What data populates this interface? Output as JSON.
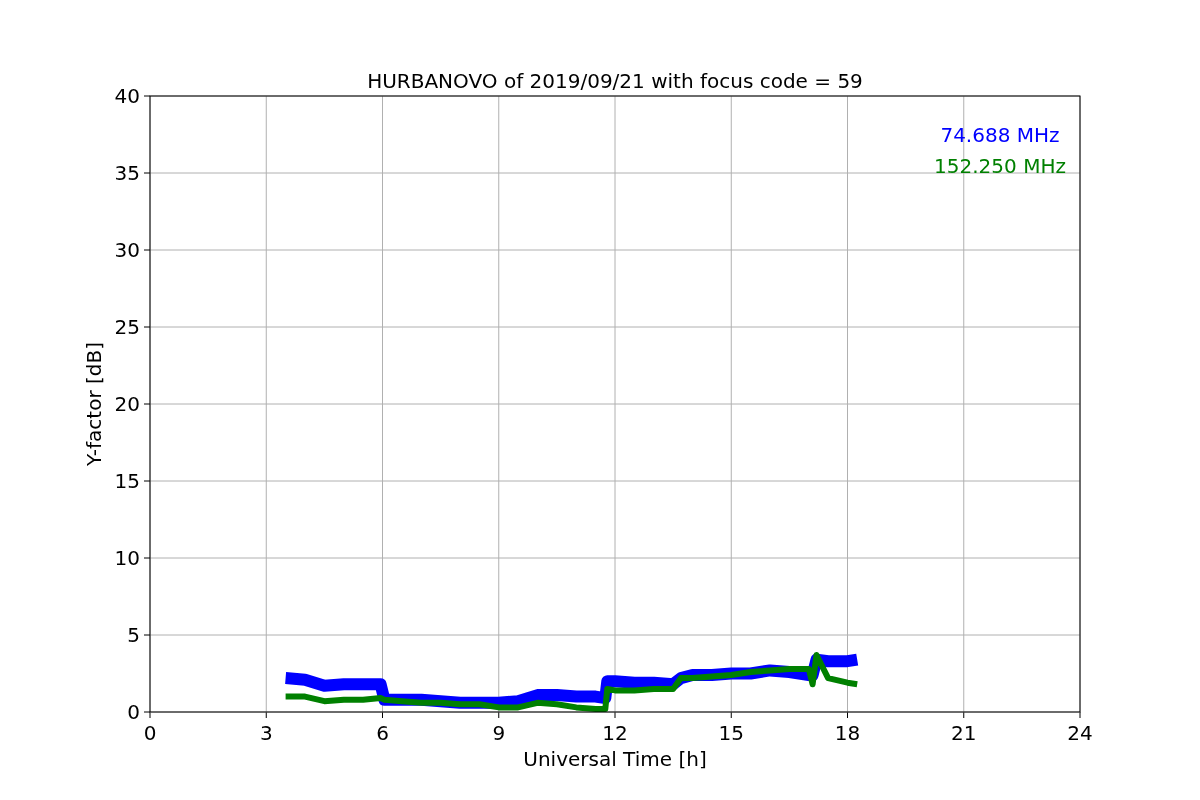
{
  "chart_data": {
    "type": "line",
    "title": "HURBANOVO of 2019/09/21 with focus code = 59",
    "xlabel": "Universal Time [h]",
    "ylabel": "Y-factor [dB]",
    "x": [
      3.5,
      4,
      4.5,
      5,
      5.5,
      5.95,
      6.05,
      6.5,
      7,
      7.5,
      8,
      8.5,
      9,
      9.5,
      10,
      10.5,
      11,
      11.5,
      11.75,
      11.8,
      12,
      12.5,
      13,
      13.5,
      13.7,
      14,
      14.5,
      15,
      15.5,
      16,
      16.5,
      17,
      17.1,
      17.2,
      17.5,
      18,
      18.25
    ],
    "series": [
      {
        "name": "74.688 MHz",
        "color": "#0000ff",
        "values": [
          2.2,
          2.1,
          1.7,
          1.8,
          1.8,
          1.8,
          0.8,
          0.8,
          0.8,
          0.7,
          0.6,
          0.6,
          0.6,
          0.7,
          1.1,
          1.1,
          1.0,
          1.0,
          0.9,
          2.0,
          2.0,
          1.9,
          1.9,
          1.8,
          2.2,
          2.4,
          2.4,
          2.5,
          2.5,
          2.7,
          2.6,
          2.4,
          2.4,
          3.4,
          3.3,
          3.3,
          3.4
        ]
      },
      {
        "name": "152.250 MHz",
        "color": "#008000",
        "values": [
          1.0,
          1.0,
          0.7,
          0.8,
          0.8,
          0.9,
          0.8,
          0.7,
          0.6,
          0.6,
          0.5,
          0.5,
          0.3,
          0.3,
          0.6,
          0.5,
          0.3,
          0.2,
          0.2,
          1.5,
          1.4,
          1.4,
          1.5,
          1.5,
          2.2,
          2.2,
          2.3,
          2.4,
          2.6,
          2.7,
          2.8,
          2.8,
          1.8,
          3.7,
          2.2,
          1.9,
          1.8
        ]
      }
    ],
    "xlim": [
      0,
      24
    ],
    "ylim": [
      0,
      40
    ],
    "xticks": [
      0,
      3,
      6,
      9,
      12,
      15,
      18,
      21,
      24
    ],
    "yticks": [
      0,
      5,
      10,
      15,
      20,
      25,
      30,
      35,
      40
    ],
    "grid": true
  }
}
